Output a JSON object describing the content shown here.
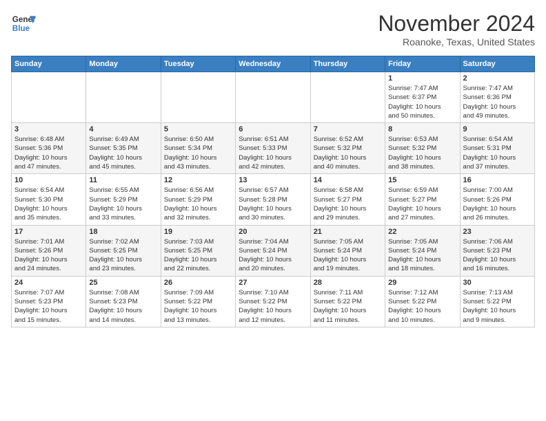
{
  "header": {
    "logo_line1": "General",
    "logo_line2": "Blue",
    "month": "November 2024",
    "location": "Roanoke, Texas, United States"
  },
  "days_of_week": [
    "Sunday",
    "Monday",
    "Tuesday",
    "Wednesday",
    "Thursday",
    "Friday",
    "Saturday"
  ],
  "weeks": [
    [
      {
        "num": "",
        "detail": ""
      },
      {
        "num": "",
        "detail": ""
      },
      {
        "num": "",
        "detail": ""
      },
      {
        "num": "",
        "detail": ""
      },
      {
        "num": "",
        "detail": ""
      },
      {
        "num": "1",
        "detail": "Sunrise: 7:47 AM\nSunset: 6:37 PM\nDaylight: 10 hours\nand 50 minutes."
      },
      {
        "num": "2",
        "detail": "Sunrise: 7:47 AM\nSunset: 6:36 PM\nDaylight: 10 hours\nand 49 minutes."
      }
    ],
    [
      {
        "num": "3",
        "detail": "Sunrise: 6:48 AM\nSunset: 5:36 PM\nDaylight: 10 hours\nand 47 minutes."
      },
      {
        "num": "4",
        "detail": "Sunrise: 6:49 AM\nSunset: 5:35 PM\nDaylight: 10 hours\nand 45 minutes."
      },
      {
        "num": "5",
        "detail": "Sunrise: 6:50 AM\nSunset: 5:34 PM\nDaylight: 10 hours\nand 43 minutes."
      },
      {
        "num": "6",
        "detail": "Sunrise: 6:51 AM\nSunset: 5:33 PM\nDaylight: 10 hours\nand 42 minutes."
      },
      {
        "num": "7",
        "detail": "Sunrise: 6:52 AM\nSunset: 5:32 PM\nDaylight: 10 hours\nand 40 minutes."
      },
      {
        "num": "8",
        "detail": "Sunrise: 6:53 AM\nSunset: 5:32 PM\nDaylight: 10 hours\nand 38 minutes."
      },
      {
        "num": "9",
        "detail": "Sunrise: 6:54 AM\nSunset: 5:31 PM\nDaylight: 10 hours\nand 37 minutes."
      }
    ],
    [
      {
        "num": "10",
        "detail": "Sunrise: 6:54 AM\nSunset: 5:30 PM\nDaylight: 10 hours\nand 35 minutes."
      },
      {
        "num": "11",
        "detail": "Sunrise: 6:55 AM\nSunset: 5:29 PM\nDaylight: 10 hours\nand 33 minutes."
      },
      {
        "num": "12",
        "detail": "Sunrise: 6:56 AM\nSunset: 5:29 PM\nDaylight: 10 hours\nand 32 minutes."
      },
      {
        "num": "13",
        "detail": "Sunrise: 6:57 AM\nSunset: 5:28 PM\nDaylight: 10 hours\nand 30 minutes."
      },
      {
        "num": "14",
        "detail": "Sunrise: 6:58 AM\nSunset: 5:27 PM\nDaylight: 10 hours\nand 29 minutes."
      },
      {
        "num": "15",
        "detail": "Sunrise: 6:59 AM\nSunset: 5:27 PM\nDaylight: 10 hours\nand 27 minutes."
      },
      {
        "num": "16",
        "detail": "Sunrise: 7:00 AM\nSunset: 5:26 PM\nDaylight: 10 hours\nand 26 minutes."
      }
    ],
    [
      {
        "num": "17",
        "detail": "Sunrise: 7:01 AM\nSunset: 5:26 PM\nDaylight: 10 hours\nand 24 minutes."
      },
      {
        "num": "18",
        "detail": "Sunrise: 7:02 AM\nSunset: 5:25 PM\nDaylight: 10 hours\nand 23 minutes."
      },
      {
        "num": "19",
        "detail": "Sunrise: 7:03 AM\nSunset: 5:25 PM\nDaylight: 10 hours\nand 22 minutes."
      },
      {
        "num": "20",
        "detail": "Sunrise: 7:04 AM\nSunset: 5:24 PM\nDaylight: 10 hours\nand 20 minutes."
      },
      {
        "num": "21",
        "detail": "Sunrise: 7:05 AM\nSunset: 5:24 PM\nDaylight: 10 hours\nand 19 minutes."
      },
      {
        "num": "22",
        "detail": "Sunrise: 7:05 AM\nSunset: 5:24 PM\nDaylight: 10 hours\nand 18 minutes."
      },
      {
        "num": "23",
        "detail": "Sunrise: 7:06 AM\nSunset: 5:23 PM\nDaylight: 10 hours\nand 16 minutes."
      }
    ],
    [
      {
        "num": "24",
        "detail": "Sunrise: 7:07 AM\nSunset: 5:23 PM\nDaylight: 10 hours\nand 15 minutes."
      },
      {
        "num": "25",
        "detail": "Sunrise: 7:08 AM\nSunset: 5:23 PM\nDaylight: 10 hours\nand 14 minutes."
      },
      {
        "num": "26",
        "detail": "Sunrise: 7:09 AM\nSunset: 5:22 PM\nDaylight: 10 hours\nand 13 minutes."
      },
      {
        "num": "27",
        "detail": "Sunrise: 7:10 AM\nSunset: 5:22 PM\nDaylight: 10 hours\nand 12 minutes."
      },
      {
        "num": "28",
        "detail": "Sunrise: 7:11 AM\nSunset: 5:22 PM\nDaylight: 10 hours\nand 11 minutes."
      },
      {
        "num": "29",
        "detail": "Sunrise: 7:12 AM\nSunset: 5:22 PM\nDaylight: 10 hours\nand 10 minutes."
      },
      {
        "num": "30",
        "detail": "Sunrise: 7:13 AM\nSunset: 5:22 PM\nDaylight: 10 hours\nand 9 minutes."
      }
    ]
  ]
}
